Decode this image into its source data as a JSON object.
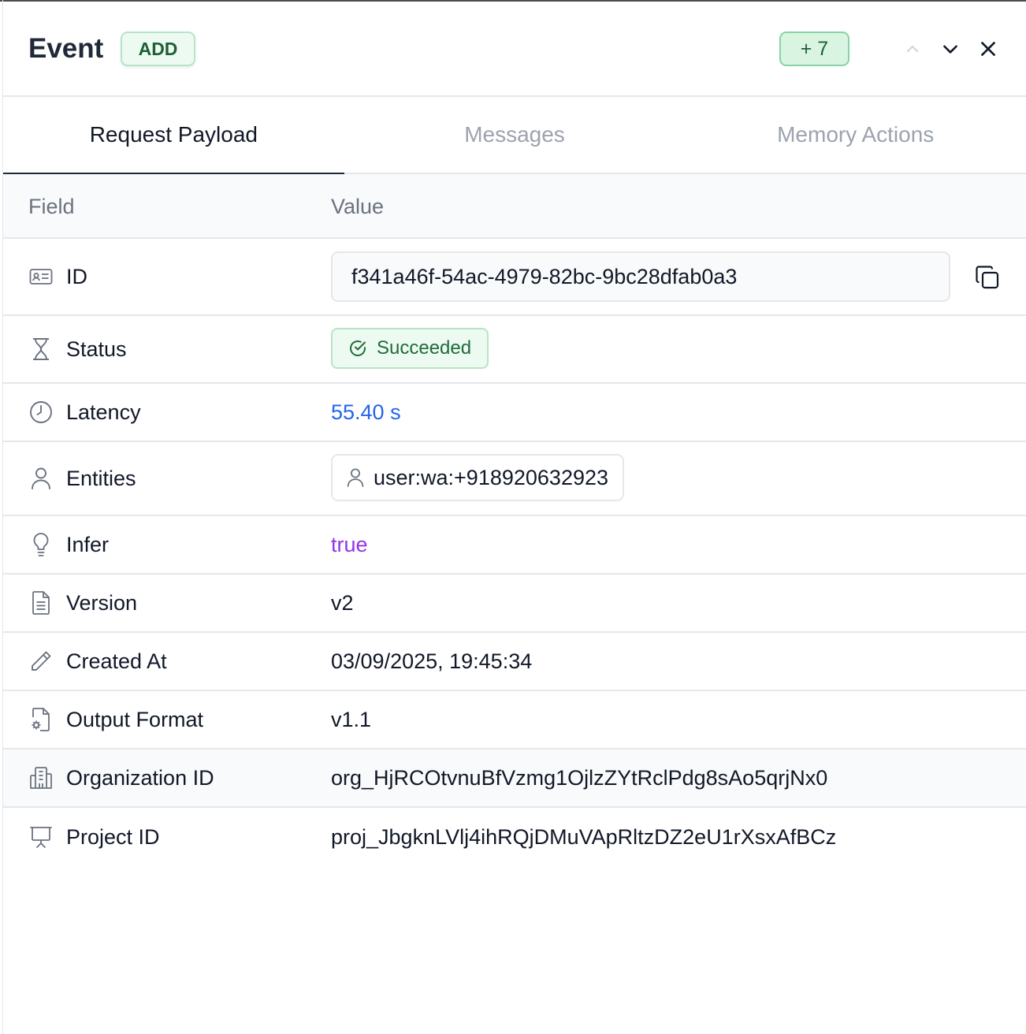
{
  "header": {
    "title": "Event",
    "event_type_badge": "ADD",
    "count_badge": "+ 7"
  },
  "tabs": [
    {
      "label": "Request Payload",
      "active": true
    },
    {
      "label": "Messages",
      "active": false
    },
    {
      "label": "Memory Actions",
      "active": false
    }
  ],
  "table": {
    "headers": {
      "field": "Field",
      "value": "Value"
    },
    "rows": {
      "id": {
        "label": "ID",
        "icon": "id-card-icon",
        "value": "f341a46f-54ac-4979-82bc-9bc28dfab0a3"
      },
      "status": {
        "label": "Status",
        "icon": "hourglass-icon",
        "value": "Succeeded"
      },
      "latency": {
        "label": "Latency",
        "icon": "clock-icon",
        "value": "55.40 s"
      },
      "entities": {
        "label": "Entities",
        "icon": "user-icon",
        "value": "user:wa:+918920632923"
      },
      "infer": {
        "label": "Infer",
        "icon": "lightbulb-icon",
        "value": "true"
      },
      "version": {
        "label": "Version",
        "icon": "document-icon",
        "value": "v2"
      },
      "created_at": {
        "label": "Created At",
        "icon": "pencil-icon",
        "value": "03/09/2025, 19:45:34"
      },
      "output_format": {
        "label": "Output Format",
        "icon": "file-settings-icon",
        "value": "v1.1"
      },
      "organization_id": {
        "label": "Organization ID",
        "icon": "building-icon",
        "value": "org_HjRCOtvnuBfVzmg1OjlzZYtRclPdg8sAo5qrjNx0"
      },
      "project_id": {
        "label": "Project ID",
        "icon": "presentation-icon",
        "value": "proj_JbgknLVlj4ihRQjDMuVApRltzDZ2eU1rXsxAfBCz"
      }
    }
  },
  "colors": {
    "accent_green": "#1f6b3a",
    "latency_blue": "#2563eb",
    "infer_purple": "#9333ea"
  }
}
